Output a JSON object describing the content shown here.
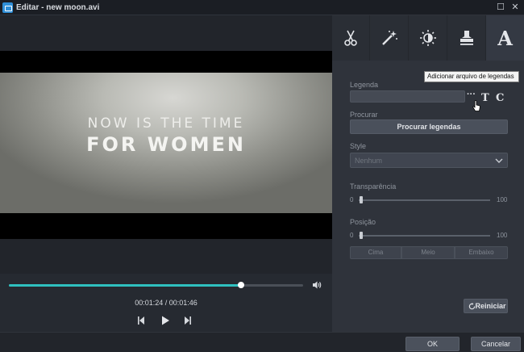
{
  "window": {
    "title": "Editar - new moon.avi",
    "restore_glyph": "☐",
    "close_glyph": "✕"
  },
  "video": {
    "caption_line1": "NOW IS THE TIME",
    "caption_line2": "FOR WOMEN"
  },
  "player": {
    "time": "00:01:24 / 00:01:46",
    "progress": 0.79,
    "icons": [
      "volume-icon",
      "previous-frame-icon",
      "play-icon",
      "next-frame-icon"
    ]
  },
  "tabs": [
    {
      "name": "cut",
      "icon": "scissors-icon"
    },
    {
      "name": "effects",
      "icon": "magic-wand-icon"
    },
    {
      "name": "adjust",
      "icon": "brightness-icon"
    },
    {
      "name": "watermark",
      "icon": "stamp-icon"
    },
    {
      "name": "subtitles",
      "icon": "text-a-icon",
      "glyph": "A",
      "active": true
    }
  ],
  "subtitle_panel": {
    "legenda_label": "Legenda",
    "legenda_value": "",
    "browse_glyph": "···",
    "text_glyph": "T",
    "c_glyph": "C",
    "tooltip": "Adicionar arquivo de legendas",
    "procurar_label": "Procurar",
    "procurar_button": "Procurar legendas",
    "style_label": "Style",
    "style_value": "Nenhum",
    "transparencia_label": "Transparência",
    "transparencia": {
      "min": "0",
      "max": "100",
      "value": 0
    },
    "posicao_label": "Posição",
    "posicao": {
      "min": "0",
      "max": "100",
      "value": 0
    },
    "position_buttons": [
      "Cima",
      "Meio",
      "Embaixo"
    ],
    "reset_label": "Reiniciar"
  },
  "footer": {
    "ok_label": "OK",
    "cancel_label": "Cancelar"
  },
  "colors": {
    "accent": "#2fc0c0",
    "panel_bg": "#2f333b",
    "button_bg": "#4a505b"
  }
}
